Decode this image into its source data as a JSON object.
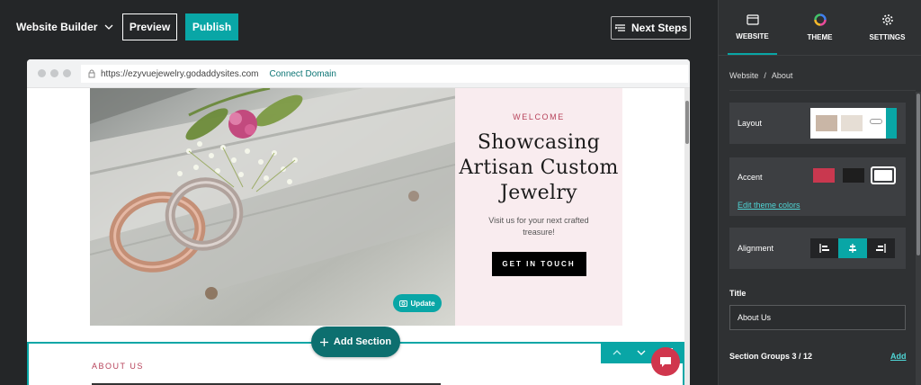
{
  "topbar": {
    "app_name": "Website Builder",
    "preview_label": "Preview",
    "publish_label": "Publish",
    "next_steps_label": "Next Steps"
  },
  "browser": {
    "url": "https://ezyvuejewelry.godaddysites.com",
    "connect_domain_label": "Connect Domain"
  },
  "hero": {
    "eyebrow": "WELCOME",
    "headline": "Showcasing Artisan Custom Jewelry",
    "subline": "Visit us for your next crafted treasure!",
    "cta_label": "GET IN TOUCH",
    "update_label": "Update"
  },
  "section2": {
    "heading": "ABOUT US"
  },
  "add_section_label": "Add Section",
  "sidebar": {
    "tabs": [
      {
        "label": "WEBSITE",
        "icon": "window-icon",
        "active": true
      },
      {
        "label": "THEME",
        "icon": "color-wheel-icon",
        "active": false
      },
      {
        "label": "SETTINGS",
        "icon": "gear-icon",
        "active": false
      }
    ],
    "breadcrumb": {
      "root": "Website",
      "separator": "/",
      "current": "About"
    },
    "layout_label": "Layout",
    "accent_label": "Accent",
    "accent_colors": [
      "#c9384f",
      "#1e1e1e",
      "#ffffff"
    ],
    "edit_theme_colors_label": "Edit theme colors",
    "alignment_label": "Alignment",
    "alignment_selected": "center",
    "title_label": "Title",
    "title_value": "About Us",
    "section_groups_label": "Section Groups 3 / 12",
    "add_label": "Add"
  },
  "colors": {
    "accent_teal": "#09a6a6",
    "brand_dark": "#242628",
    "hero_pink": "#f9ecef",
    "welcome_rose": "#b7425a"
  }
}
